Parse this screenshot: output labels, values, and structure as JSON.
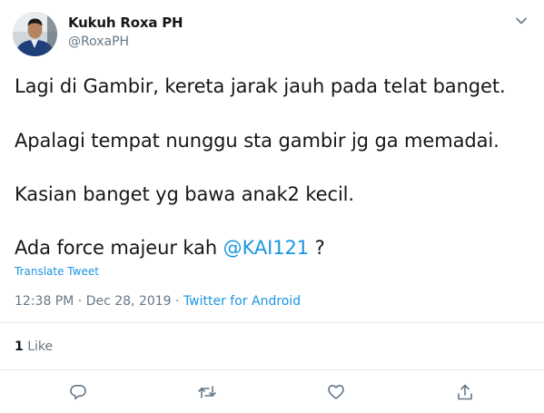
{
  "author": {
    "name": "Kukuh Roxa PH",
    "handle": "@RoxaPH"
  },
  "tweet": {
    "line1": "Lagi di Gambir, kereta jarak jauh pada telat banget.",
    "line2": "Apalagi tempat nunggu sta gambir jg ga memadai.",
    "line3": "Kasian banget yg bawa anak2 kecil.",
    "line4_prefix": "Ada force majeur kah ",
    "line4_mention": "@KAI121",
    "line4_suffix": " ?"
  },
  "translate_label": "Translate Tweet",
  "meta": {
    "time": "12:38 PM",
    "separator1": " · ",
    "date": "Dec 28, 2019",
    "separator2": " · ",
    "source": "Twitter for Android"
  },
  "stats": {
    "likes_count": "1",
    "likes_label": " Like"
  },
  "icons": {
    "caret": "chevron-down-icon",
    "reply": "reply-icon",
    "retweet": "retweet-icon",
    "like": "heart-icon",
    "share": "share-icon"
  },
  "colors": {
    "link": "#1b95e0",
    "secondary_text": "#657786",
    "primary_text": "#14171a",
    "divider": "#e6ecf0"
  }
}
